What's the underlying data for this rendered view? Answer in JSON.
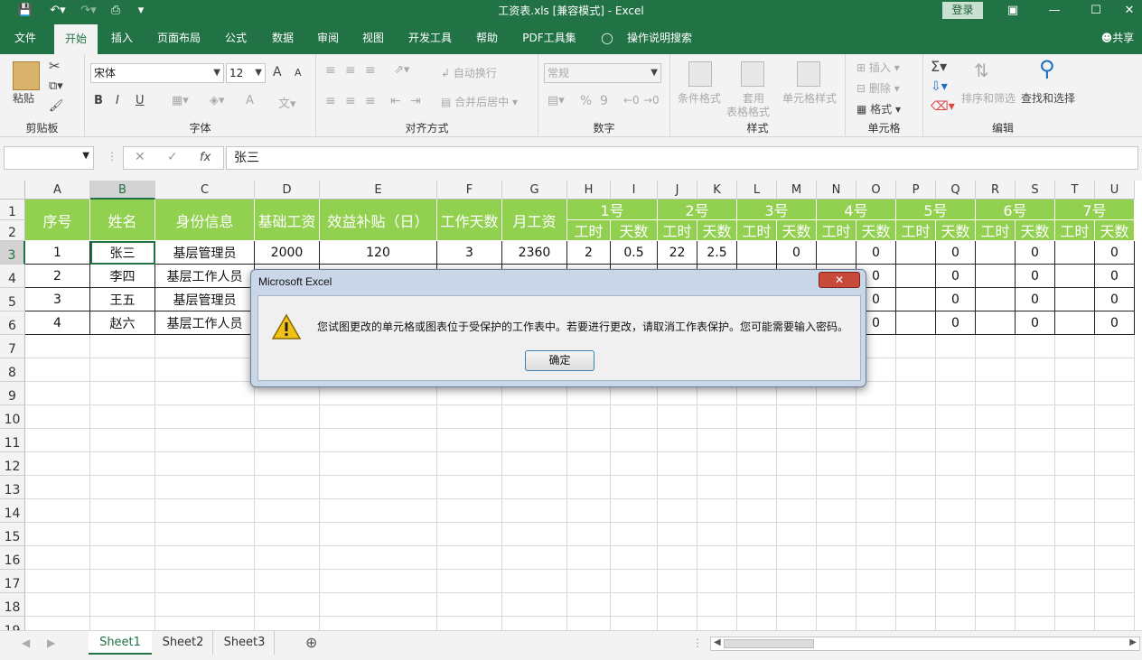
{
  "titlebar": {
    "title": "工资表.xls  [兼容模式]  -  Excel",
    "login": "登录"
  },
  "tabs": [
    "文件",
    "开始",
    "插入",
    "页面布局",
    "公式",
    "数据",
    "审阅",
    "视图",
    "开发工具",
    "帮助",
    "PDF工具集"
  ],
  "tell_me": "操作说明搜索",
  "share": "共享",
  "ribbon": {
    "clipboard": {
      "label": "剪贴板",
      "paste": "粘贴"
    },
    "font": {
      "label": "字体",
      "name": "宋体",
      "size": "12",
      "bold": "B",
      "italic": "I",
      "underline": "U",
      "grow": "A",
      "shrink": "A",
      "fontcolor": "A"
    },
    "align": {
      "label": "对齐方式",
      "wrap": "自动换行",
      "merge": "合并后居中"
    },
    "number": {
      "label": "数字",
      "format": "常规",
      "percent": "%",
      "comma": "9"
    },
    "styles": {
      "label": "样式",
      "cond": "条件格式",
      "table1": "套用",
      "table2": "表格格式",
      "cellstyle": "单元格样式"
    },
    "cells": {
      "label": "单元格",
      "insert": "插入",
      "delete": "删除",
      "format": "格式"
    },
    "edit": {
      "label": "编辑",
      "sort": "排序和筛选",
      "find": "查找和选择"
    }
  },
  "formula": {
    "fx": "fx",
    "value": "张三"
  },
  "columns": [
    "A",
    "B",
    "C",
    "D",
    "E",
    "F",
    "G",
    "H",
    "I",
    "J",
    "K",
    "L",
    "M",
    "N",
    "O",
    "P",
    "Q",
    "R",
    "S",
    "T",
    "U"
  ],
  "rows": [
    "1",
    "2",
    "3",
    "4",
    "5",
    "6",
    "7",
    "8",
    "9",
    "10",
    "11",
    "12",
    "13",
    "14",
    "15",
    "16",
    "17",
    "18",
    "19"
  ],
  "header": {
    "seq": "序号",
    "name": "姓名",
    "identity": "身份信息",
    "base": "基础工资",
    "subsidy": "效益补贴（日）",
    "workdays": "工作天数",
    "monthly": "月工资",
    "days": [
      "1号",
      "2号",
      "3号",
      "4号",
      "5号",
      "6号",
      "7号"
    ],
    "hours": "工时",
    "daycount": "天数"
  },
  "data_rows": [
    {
      "seq": "1",
      "name": "张三",
      "identity": "基层管理员",
      "base": "2000",
      "subsidy": "120",
      "workdays": "3",
      "monthly": "2360",
      "days": [
        "2",
        "0.5",
        "22",
        "2.5",
        "",
        "0",
        "",
        "0",
        "",
        "0",
        "",
        "0",
        "",
        "0"
      ]
    },
    {
      "seq": "2",
      "name": "李四",
      "identity": "基层工作人员",
      "days_tail": [
        "0",
        "0",
        "0",
        "0"
      ]
    },
    {
      "seq": "3",
      "name": "王五",
      "identity": "基层管理员",
      "days_tail": [
        "0",
        "0",
        "0",
        "0"
      ]
    },
    {
      "seq": "4",
      "name": "赵六",
      "identity": "基层工作人员",
      "days_tail": [
        "0",
        "0",
        "0",
        "0"
      ]
    }
  ],
  "sheets": [
    "Sheet1",
    "Sheet2",
    "Sheet3"
  ],
  "dialog": {
    "title": "Microsoft Excel",
    "message": "您试图更改的单元格或图表位于受保护的工作表中。若要进行更改，请取消工作表保护。您可能需要输入密码。",
    "ok": "确定"
  }
}
